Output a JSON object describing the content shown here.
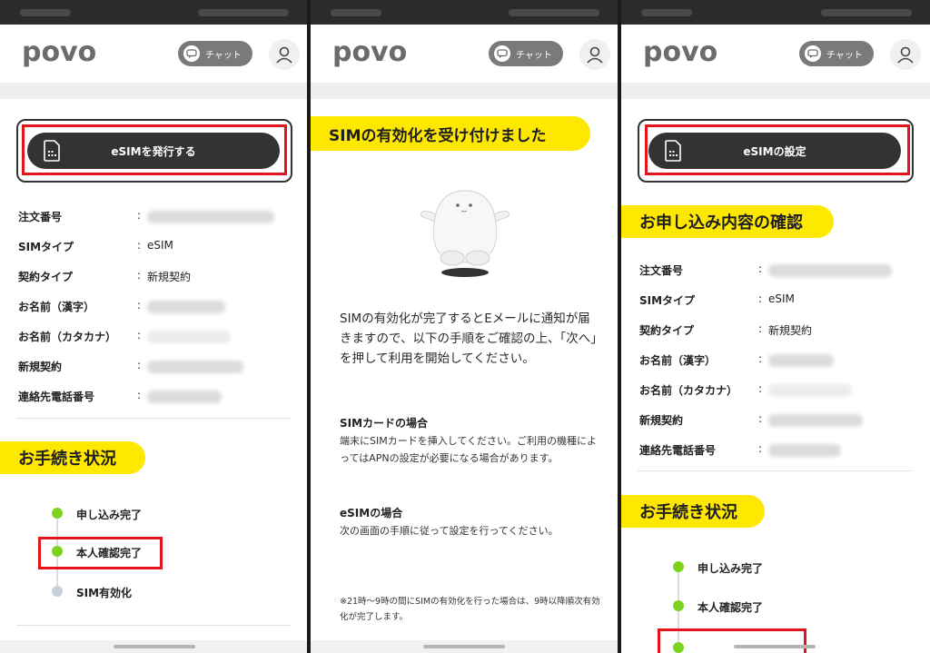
{
  "header": {
    "logo": "povo",
    "chat_label": "チャット"
  },
  "panel1": {
    "esim_button": "eSIMを発行する",
    "info": [
      {
        "label": "注文番号",
        "value": null
      },
      {
        "label": "SIMタイプ",
        "value": "eSIM"
      },
      {
        "label": "契約タイプ",
        "value": "新規契約"
      },
      {
        "label": "お名前（漢字）",
        "value": null
      },
      {
        "label": "お名前（カタカナ）",
        "value": null
      },
      {
        "label": "新規契約",
        "value": null
      },
      {
        "label": "連絡先電話番号",
        "value": null
      }
    ],
    "section_title": "お手続き状況",
    "steps": [
      {
        "label": "申し込み完了",
        "status": "done"
      },
      {
        "label": "本人確認完了",
        "status": "done"
      },
      {
        "label": "SIM有効化",
        "status": "pending"
      }
    ]
  },
  "panel2": {
    "title": "SIMの有効化を受け付けました",
    "intro": "SIMの有効化が完了するとEメールに通知が届きますので、以下の手順をご確認の上、「次へ」を押して利用を開始してください。",
    "sim_card_heading": "SIMカードの場合",
    "sim_card_text": "端末にSIMカードを挿入してください。ご利用の機種によってはAPNの設定が必要になる場合があります。",
    "esim_heading": "eSIMの場合",
    "esim_text": "次の画面の手順に従って設定を行ってください。",
    "note": "※21時〜9時の間にSIMの有効化を行った場合は、9時以降順次有効化が完了します。"
  },
  "panel3": {
    "esim_button": "eSIMの設定",
    "confirm_title": "お申し込み内容の確認",
    "info": [
      {
        "label": "注文番号",
        "value": null
      },
      {
        "label": "SIMタイプ",
        "value": "eSIM"
      },
      {
        "label": "契約タイプ",
        "value": "新規契約"
      },
      {
        "label": "お名前（漢字）",
        "value": null
      },
      {
        "label": "お名前（カタカナ）",
        "value": null
      },
      {
        "label": "新規契約",
        "value": null
      },
      {
        "label": "連絡先電話番号",
        "value": null
      }
    ],
    "section_title": "お手続き状況",
    "steps": [
      {
        "label": "申し込み完了",
        "status": "done"
      },
      {
        "label": "本人確認完了",
        "status": "done"
      }
    ]
  },
  "colors": {
    "accent_yellow": "#ffe800",
    "highlight_red": "#e3141b",
    "step_done": "#7bd21f",
    "step_pending": "#c9d0d8",
    "button_dark": "#333333"
  }
}
